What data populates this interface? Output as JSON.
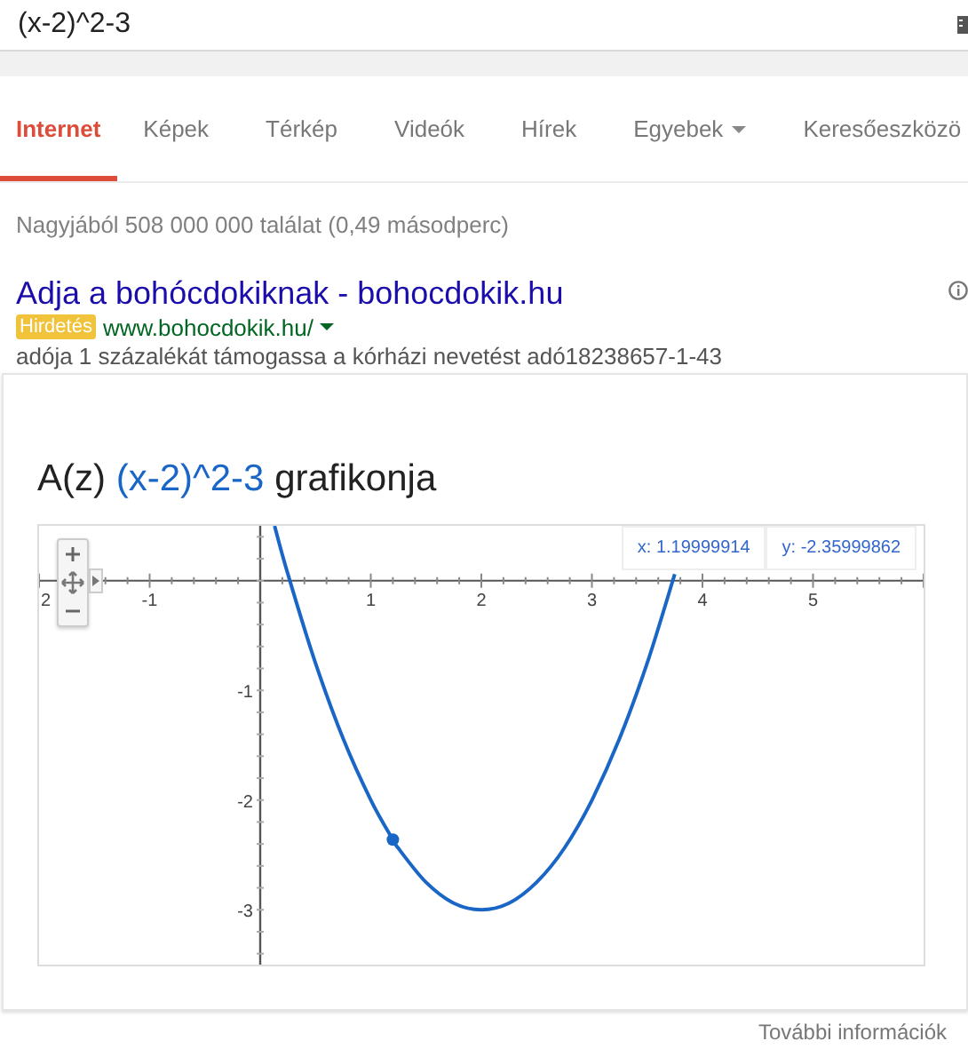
{
  "search": {
    "value": "(x-2)^2-3"
  },
  "tabs": [
    {
      "label": "Internet",
      "selected": true
    },
    {
      "label": "Képek",
      "selected": false
    },
    {
      "label": "Térkép",
      "selected": false
    },
    {
      "label": "Videók",
      "selected": false
    },
    {
      "label": "Hírek",
      "selected": false
    },
    {
      "label": "Egyebek",
      "selected": false,
      "kind": "menu"
    },
    {
      "label": "Keresőeszközö",
      "selected": false
    }
  ],
  "result_stats": "Nagyjából 508 000 000 találat (0,49 másodperc)",
  "ad": {
    "title": "Adja a bohócdokiknak - bohocdokik.hu",
    "badge": "Hirdetés",
    "url": "www.bohocdokik.hu/",
    "description": "adója 1 százalékát támogassa a kórházi nevetést adó18238657-1-43"
  },
  "graph_card": {
    "title_prefix": "A(z)",
    "title_formula": "(x-2)^2-3",
    "title_suffix": "grafikonja",
    "chart_data": {
      "type": "line",
      "x": [
        0.13,
        0.25,
        0.5,
        0.75,
        1,
        1.2,
        1.25,
        1.5,
        1.75,
        2,
        2.25,
        2.5,
        2.75,
        3,
        3.25,
        3.5,
        3.75
      ],
      "series": [
        {
          "color": "#1a66c7",
          "values": [
            0.5,
            0.06,
            -0.75,
            -1.44,
            -2,
            -2.36,
            -2.44,
            -2.75,
            -2.94,
            -3,
            -2.94,
            -2.75,
            -2.44,
            -2,
            -1.44,
            -0.75,
            0.06
          ]
        },
        {
          "color": "#1a66c7",
          "marker": "circle",
          "values": [
            null,
            null,
            null,
            null,
            null,
            -2.36,
            null,
            null,
            null,
            null,
            null,
            null,
            null,
            null,
            null,
            null,
            null
          ]
        }
      ],
      "xlim": [
        -2,
        6
      ],
      "ylim": [
        -3.5,
        0.5
      ],
      "xticks": [
        {
          "value": -2,
          "label": "2"
        },
        -1,
        1,
        2,
        3,
        4,
        5
      ],
      "yticks": [
        -1,
        -2,
        -3
      ],
      "annotations": [
        "x: 1.19999914",
        "y: -2.35999862"
      ]
    }
  },
  "footer_link": "További információk"
}
